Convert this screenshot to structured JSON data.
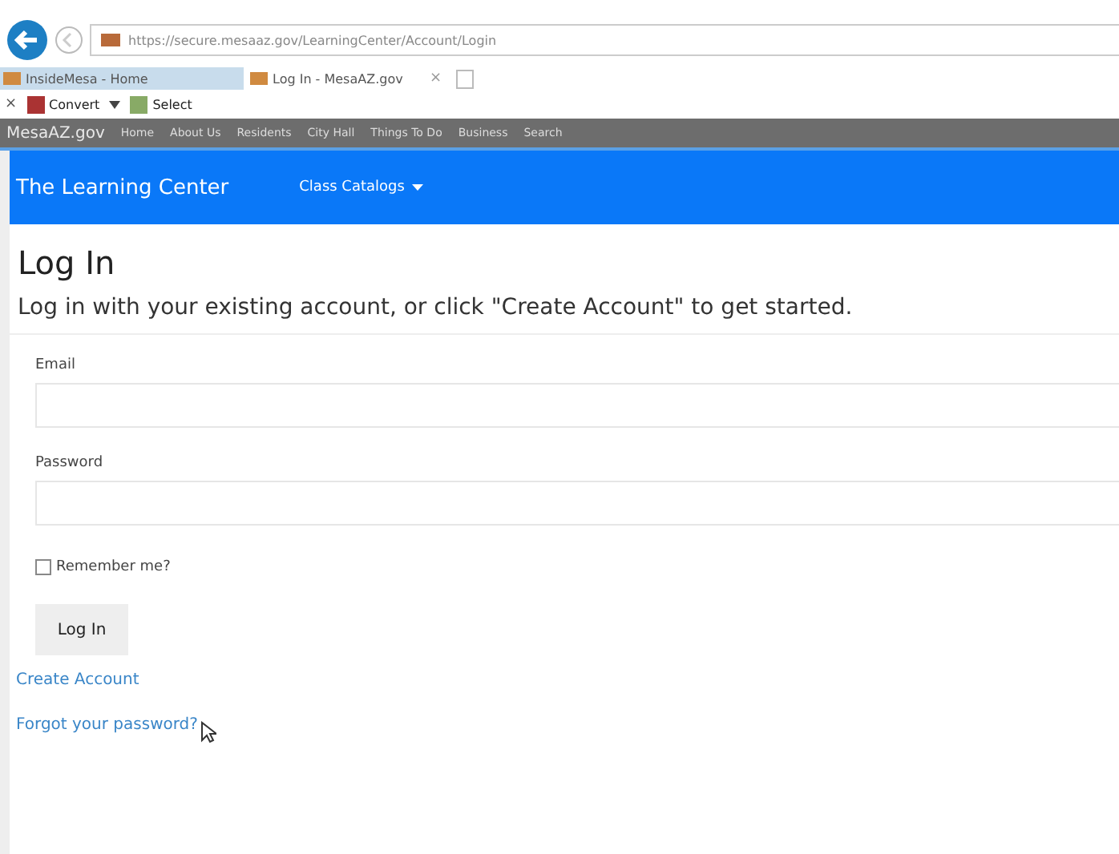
{
  "browser": {
    "address": "https://secure.mesaaz.gov/LearningCenter/Account/Login",
    "tabs": [
      {
        "label": "InsideMesa - Home",
        "selected": false
      },
      {
        "label": "Log In - MesaAZ.gov",
        "selected": true
      }
    ],
    "tab_close": "×",
    "toolbar": {
      "close": "×",
      "items": [
        "Convert",
        "Select"
      ]
    }
  },
  "site_nav": {
    "brand": "MesaAZ.gov",
    "items": [
      "Home",
      "About Us",
      "Residents",
      "City Hall",
      "Things To Do",
      "Business",
      "Search"
    ]
  },
  "app_nav": {
    "brand": "The Learning Center",
    "menu": "Class Catalogs"
  },
  "page": {
    "title": "Log In",
    "subtitle": "Log in with your existing account, or click \"Create Account\" to get started.",
    "fields": [
      {
        "label": "Email"
      },
      {
        "label": "Password"
      }
    ],
    "remember": {
      "label": "Remember me?",
      "checked": false
    },
    "submit": "Log In",
    "links": [
      "Create Account",
      "Forgot your password?"
    ]
  }
}
